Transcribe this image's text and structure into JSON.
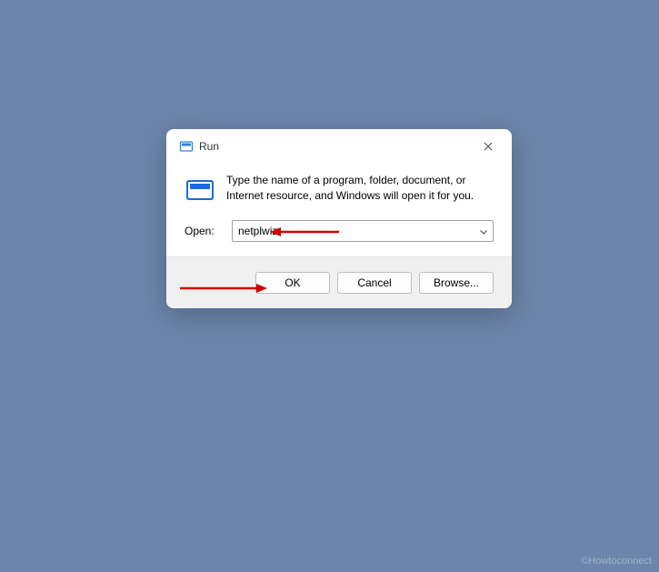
{
  "dialog": {
    "title": "Run",
    "description": "Type the name of a program, folder, document, or Internet resource, and Windows will open it for you.",
    "open_label": "Open:",
    "open_value": "netplwiz",
    "buttons": {
      "ok": "OK",
      "cancel": "Cancel",
      "browse": "Browse..."
    }
  },
  "watermark": "©Howtoconnect",
  "annotations": {
    "arrow1_target": "open-input",
    "arrow2_target": "ok-button"
  }
}
